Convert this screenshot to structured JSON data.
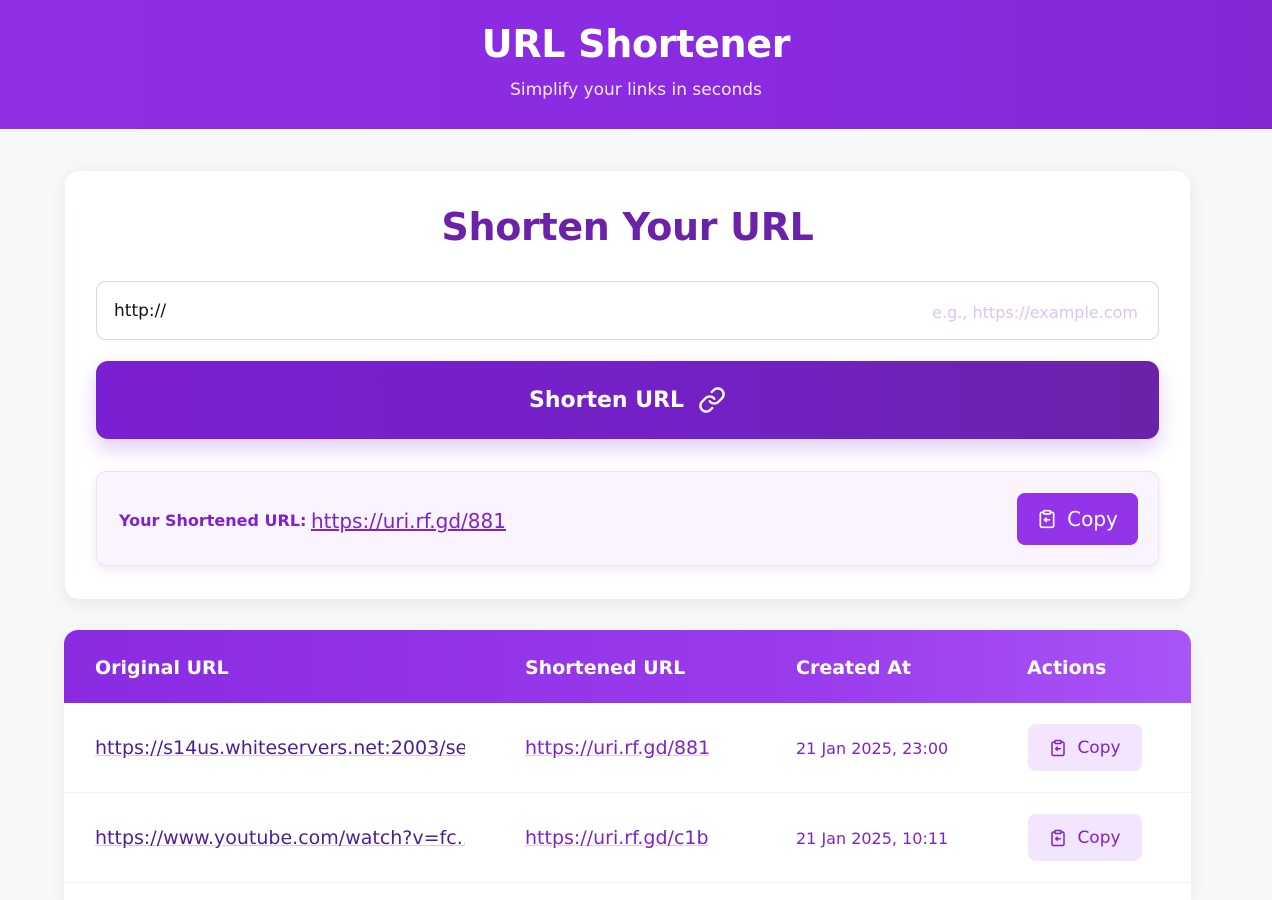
{
  "header": {
    "title": "URL Shortener",
    "subtitle": "Simplify your links in seconds"
  },
  "form": {
    "title": "Shorten Your URL",
    "input_value": "http://",
    "input_placeholder": "e.g., https://example.com",
    "submit_label": "Shorten URL",
    "submit_icon": "link-icon"
  },
  "result": {
    "label": "Your Shortened URL:",
    "url": "https://uri.rf.gd/881",
    "copy_label": "Copy",
    "copy_icon": "clipboard-icon"
  },
  "table": {
    "columns": [
      "Original URL",
      "Shortened URL",
      "Created At",
      "Actions"
    ],
    "rows": [
      {
        "original": "https://s14us.whiteservers.net:2003/se...",
        "shortened": "https://uri.rf.gd/881",
        "created_at": "21 Jan 2025, 23:00",
        "action_label": "Copy"
      },
      {
        "original": "https://www.youtube.com/watch?v=fc...",
        "shortened": "https://uri.rf.gd/c1b",
        "created_at": "21 Jan 2025, 10:11",
        "action_label": "Copy"
      }
    ]
  },
  "colors": {
    "primary": "#8a2be2",
    "primary_dark": "#6b21a8",
    "accent": "#9333ea",
    "light_accent": "#f3e5fd",
    "background": "#f7f8fa"
  }
}
